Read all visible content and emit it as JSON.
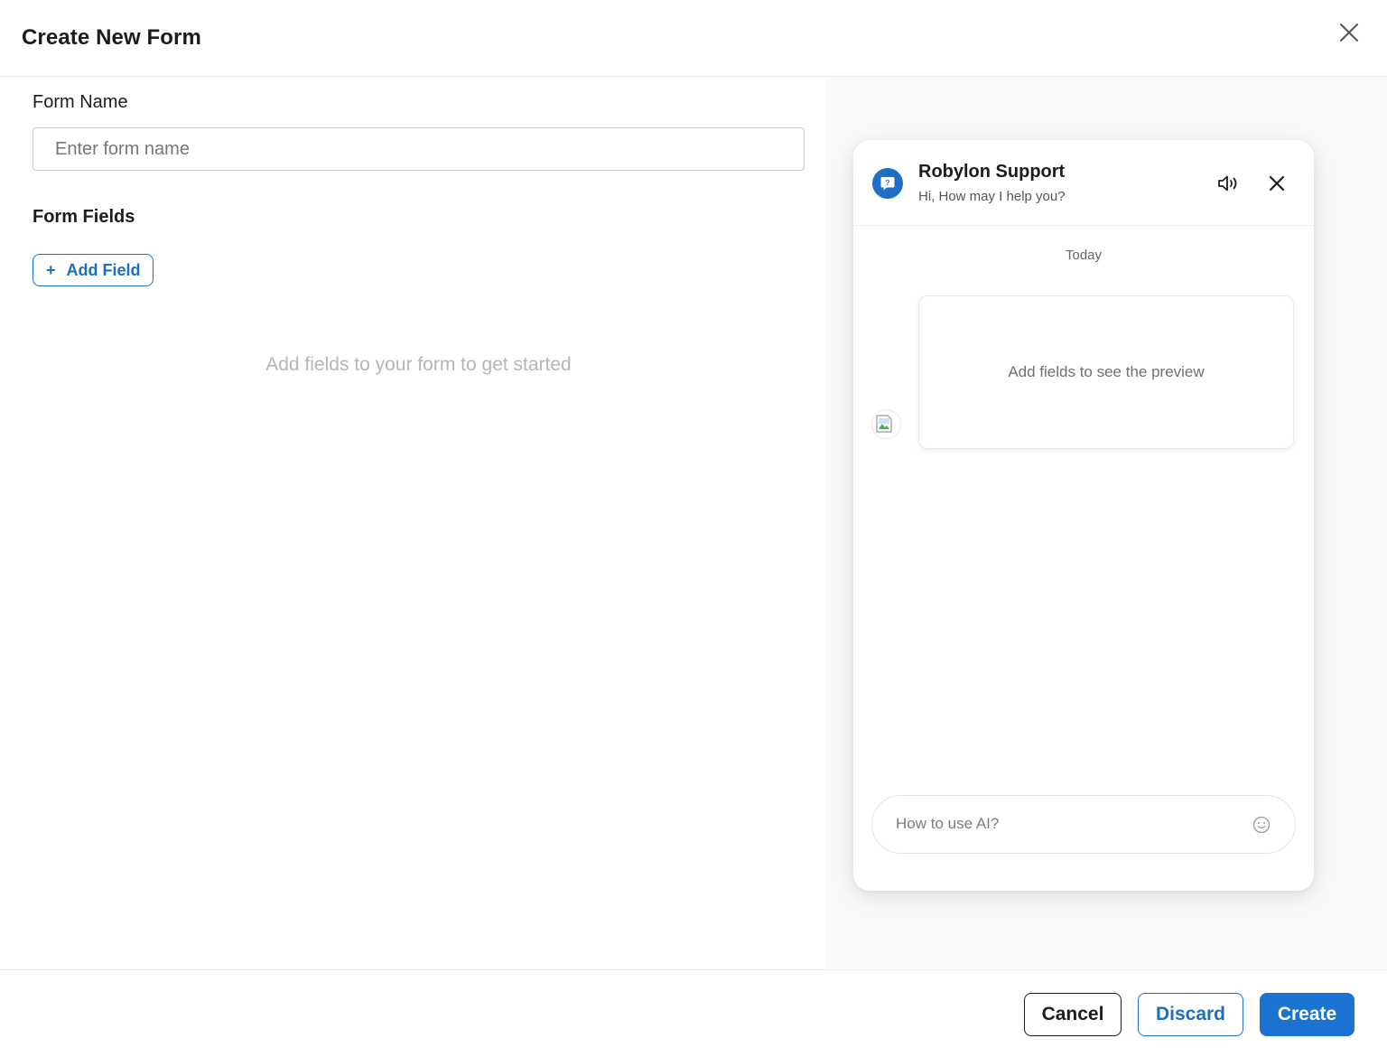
{
  "modal": {
    "title": "Create New Form"
  },
  "form": {
    "name_label": "Form Name",
    "name_placeholder": "Enter form name",
    "name_value": "",
    "fields_label": "Form Fields",
    "add_field_icon": "+",
    "add_field_label": "Add Field",
    "empty_hint": "Add fields to your form to get started"
  },
  "preview": {
    "bot_name": "Robylon Support",
    "greeting": "Hi, How may I help you?",
    "date_divider": "Today",
    "message_placeholder_text": "Add fields to see the preview",
    "input_placeholder": "How to use AI?",
    "icons": {
      "logo": "help-bubble-icon",
      "sound": "speaker-icon",
      "close": "close-icon",
      "emoji": "smiley-icon",
      "avatar": "broken-image-icon"
    }
  },
  "footer": {
    "cancel_label": "Cancel",
    "discard_label": "Discard",
    "create_label": "Create"
  },
  "colors": {
    "primary": "#1a73d1",
    "primary_text": "#1a6fbe",
    "border": "#c9c9c9",
    "muted_text": "#b5b5b5"
  }
}
